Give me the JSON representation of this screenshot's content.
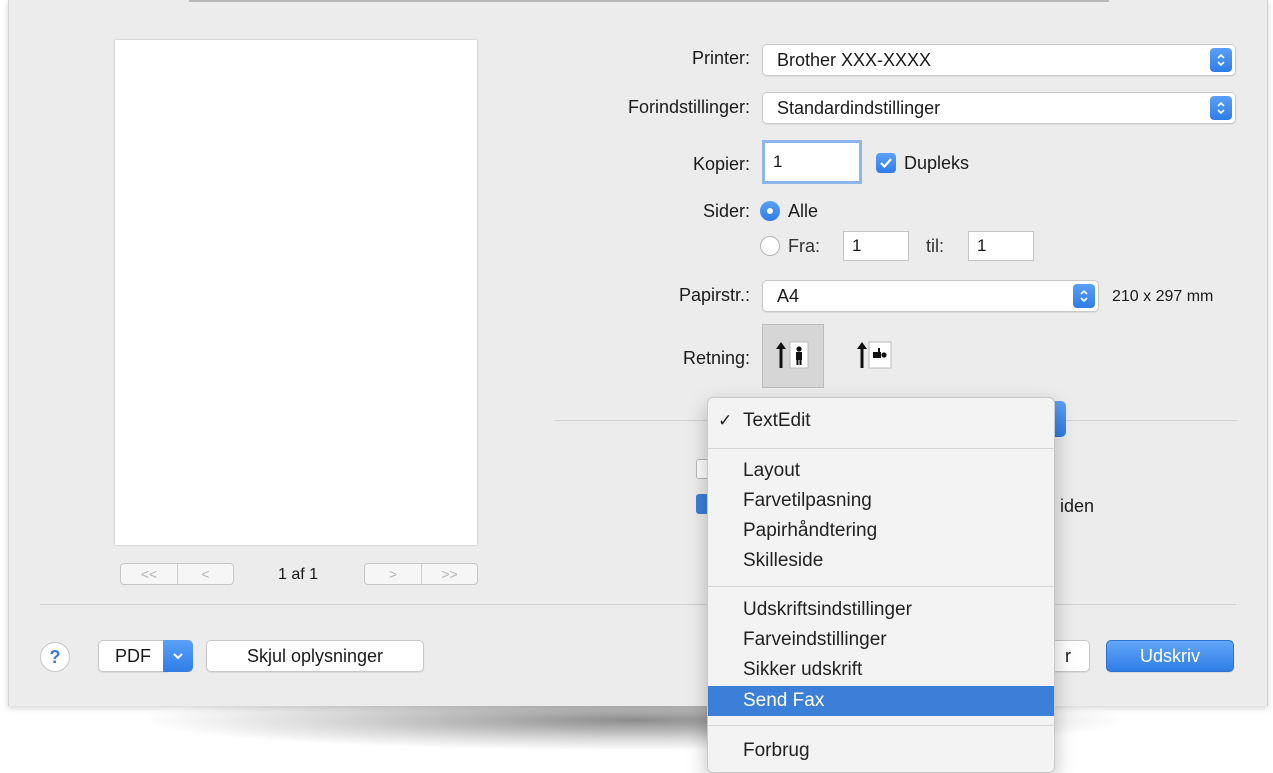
{
  "preview": {
    "page_count": "1 af 1",
    "nav_first": "<<",
    "nav_prev": "<",
    "nav_next": ">",
    "nav_last": ">>"
  },
  "printer": {
    "label": "Printer:",
    "value": "Brother XXX-XXXX"
  },
  "presets": {
    "label": "Forindstillinger:",
    "value": "Standardindstillinger"
  },
  "copies": {
    "label": "Kopier:",
    "value": "1",
    "duplex_label": "Dupleks",
    "duplex_checked": true
  },
  "pages": {
    "label": "Sider:",
    "all_label": "Alle",
    "from_label": "Fra:",
    "from_value": "1",
    "to_label": "til:",
    "to_value": "1",
    "selected": "all"
  },
  "paper": {
    "label": "Papirstr.:",
    "value": "A4",
    "dimensions": "210 x 297 mm"
  },
  "orientation": {
    "label": "Retning:",
    "selected": "portrait"
  },
  "hidden_text": {
    "right_fragment": "iden"
  },
  "menu": {
    "items": [
      {
        "label": "TextEdit",
        "checked": true
      },
      {
        "label": "Layout"
      },
      {
        "label": "Farvetilpasning"
      },
      {
        "label": "Papirhåndtering"
      },
      {
        "label": "Skilleside"
      },
      {
        "label": "Udskriftsindstillinger"
      },
      {
        "label": "Farveindstillinger"
      },
      {
        "label": "Sikker udskrift"
      },
      {
        "label": "Send Fax",
        "highlighted": true
      },
      {
        "label": "Forbrug"
      }
    ]
  },
  "footer": {
    "help_label": "?",
    "pdf_label": "PDF",
    "hide_details_label": "Skjul oplysninger",
    "cancel_fragment": "r",
    "print_label": "Udskriv"
  },
  "colors": {
    "accent": "#3c7fd8",
    "dialog_bg": "#ececec"
  }
}
